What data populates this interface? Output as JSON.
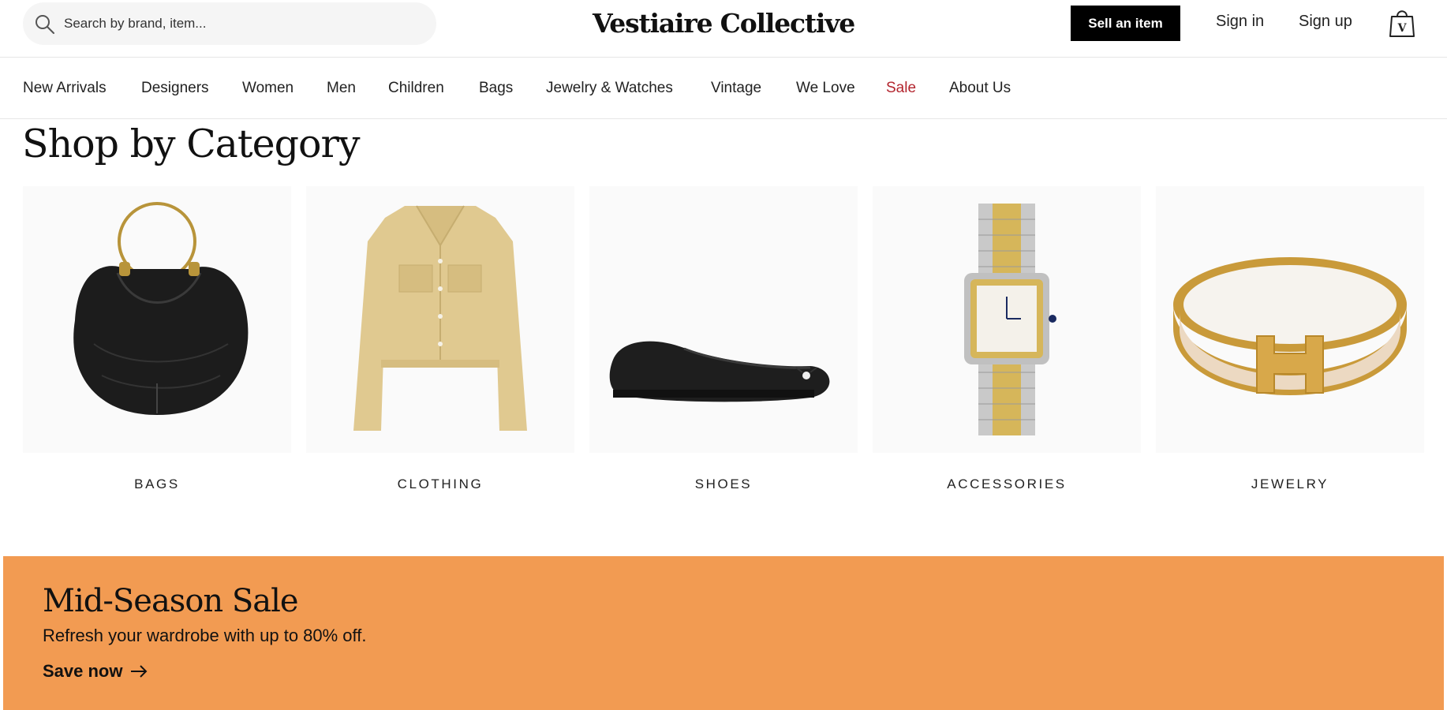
{
  "search": {
    "placeholder": "Search by brand, item..."
  },
  "logo": {
    "text": "Vestiaire Collective"
  },
  "header": {
    "sell_label": "Sell an item",
    "signin_label": "Sign in",
    "signup_label": "Sign up",
    "bag_icon": "shopping-bag-icon"
  },
  "nav": {
    "items": [
      {
        "label": "New Arrivals"
      },
      {
        "label": "Designers"
      },
      {
        "label": "Women"
      },
      {
        "label": "Men"
      },
      {
        "label": "Children"
      },
      {
        "label": "Bags"
      },
      {
        "label": "Jewelry & Watches"
      },
      {
        "label": "Vintage"
      },
      {
        "label": "We Love"
      },
      {
        "label": "Sale",
        "color": "#b3262f"
      },
      {
        "label": "About Us"
      }
    ]
  },
  "categories": {
    "title": "Shop by Category",
    "items": [
      {
        "label": "BAGS",
        "image": "black-hobo-bag-with-ring-handle"
      },
      {
        "label": "CLOTHING",
        "image": "beige-cropped-jacket"
      },
      {
        "label": "SHOES",
        "image": "black-ballet-flat"
      },
      {
        "label": "ACCESSORIES",
        "image": "two-tone-square-watch"
      },
      {
        "label": "JEWELRY",
        "image": "gold-enamel-h-bangle"
      }
    ]
  },
  "banner": {
    "title": "Mid-Season Sale",
    "subtitle": "Refresh your wardrobe with up to 80% off.",
    "cta": "Save now",
    "background": "#f29b52"
  }
}
